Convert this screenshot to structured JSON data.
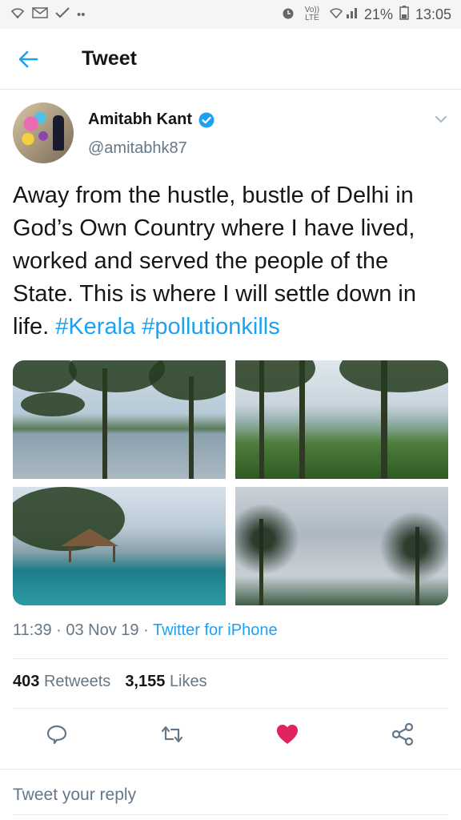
{
  "status_bar": {
    "left_icons": [
      "wifi-icon",
      "gmail-icon",
      "check-icon",
      "more-dots-icon"
    ],
    "volte": "Vo)) LTE",
    "battery": "21%",
    "time": "13:05"
  },
  "app_bar": {
    "back_icon": "arrow-left-icon",
    "title": "Tweet"
  },
  "tweet": {
    "author_name": "Amitabh Kant",
    "handle": "@amitabhk87",
    "verified": true,
    "text_plain": "Away from the hustle, bustle of Delhi in God’s Own Country where I have lived, worked and served the people of the State. This is where I will settle down in life. ",
    "hashtags": [
      "#Kerala",
      "#pollutionkills"
    ],
    "media": [
      {
        "description_icon": "lake-photo"
      },
      {
        "description_icon": "forest-lake-photo"
      },
      {
        "description_icon": "pool-hut-photo"
      },
      {
        "description_icon": "palm-sky-photo"
      }
    ],
    "time": "11:39",
    "date": "03 Nov 19",
    "source": "Twitter for iPhone",
    "retweets_count": "403",
    "retweets_label": "Retweets",
    "likes_count": "3,155",
    "likes_label": "Likes"
  },
  "actions": {
    "reply_icon": "reply-icon",
    "retweet_icon": "retweet-icon",
    "like_icon": "heart-icon",
    "share_icon": "share-icon"
  },
  "reply": {
    "placeholder": "Tweet your reply"
  },
  "colors": {
    "accent": "#1da1f2",
    "like": "#e0245e",
    "secondary_text": "#657786",
    "primary_text": "#14171a"
  }
}
